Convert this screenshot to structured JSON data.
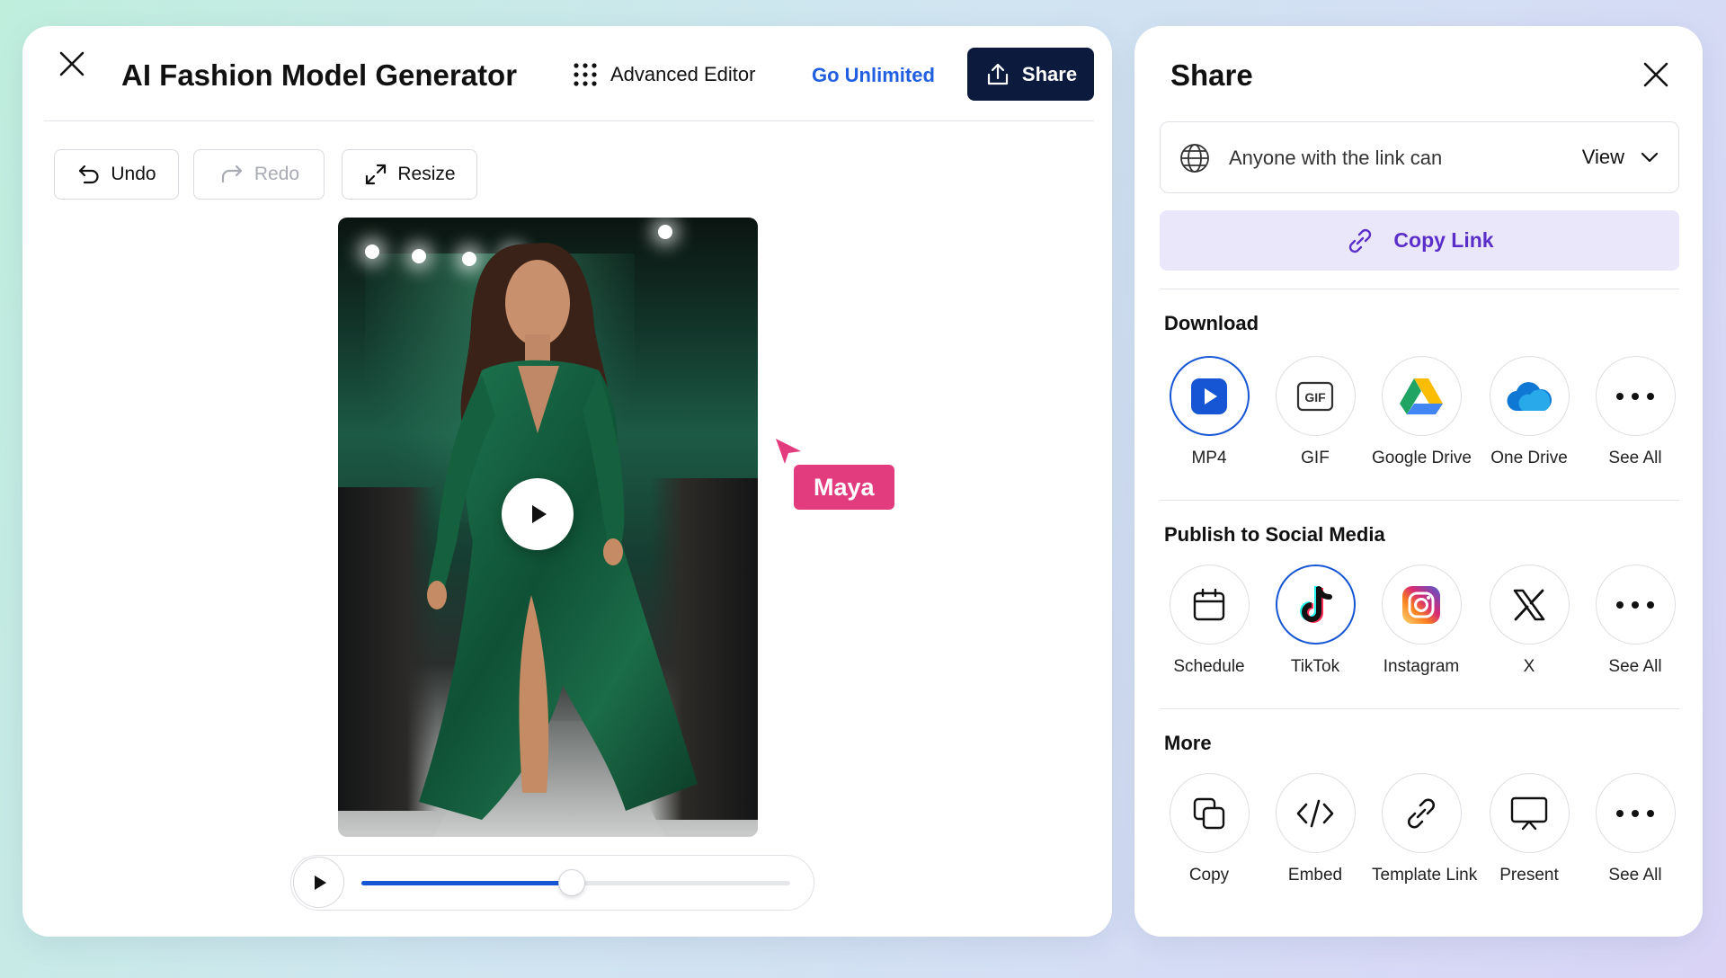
{
  "editor": {
    "title": "AI Fashion Model Generator",
    "advanced_editor_label": "Advanced Editor",
    "go_unlimited_label": "Go Unlimited",
    "share_label": "Share",
    "toolbar": {
      "undo_label": "Undo",
      "redo_label": "Redo",
      "resize_label": "Resize"
    },
    "collaborator": {
      "name": "Maya",
      "color": "#e23c7e"
    },
    "player": {
      "progress": 0.49
    }
  },
  "share_panel": {
    "title": "Share",
    "access": {
      "text": "Anyone with the link can",
      "permission": "View"
    },
    "copy_link_label": "Copy Link",
    "sections": {
      "download": {
        "title": "Download",
        "items": [
          {
            "label": "MP4",
            "icon": "mp4-play-icon",
            "selected": true
          },
          {
            "label": "GIF",
            "icon": "gif-icon",
            "badge": "GIF"
          },
          {
            "label": "Google Drive",
            "icon": "google-drive-icon"
          },
          {
            "label": "One Drive",
            "icon": "onedrive-cloud-icon"
          },
          {
            "label": "See All",
            "icon": "more-dots-icon"
          }
        ]
      },
      "social": {
        "title": "Publish to Social Media",
        "items": [
          {
            "label": "Schedule",
            "icon": "calendar-icon"
          },
          {
            "label": "TikTok",
            "icon": "tiktok-icon",
            "selected": true
          },
          {
            "label": "Instagram",
            "icon": "instagram-icon"
          },
          {
            "label": "X",
            "icon": "x-logo-icon"
          },
          {
            "label": "See All",
            "icon": "more-dots-icon"
          }
        ]
      },
      "more": {
        "title": "More",
        "items": [
          {
            "label": "Copy",
            "icon": "copy-icon"
          },
          {
            "label": "Embed",
            "icon": "code-icon"
          },
          {
            "label": "Template Link",
            "icon": "link-icon"
          },
          {
            "label": "Present",
            "icon": "present-icon"
          },
          {
            "label": "See All",
            "icon": "more-dots-icon"
          }
        ]
      }
    }
  },
  "colors": {
    "brand_navy": "#0c1b3d",
    "accent_blue": "#1656d4",
    "link_blue": "#1f5fe0",
    "copy_link_bg": "#ebe7fb",
    "copy_link_text": "#5a2fc9"
  }
}
